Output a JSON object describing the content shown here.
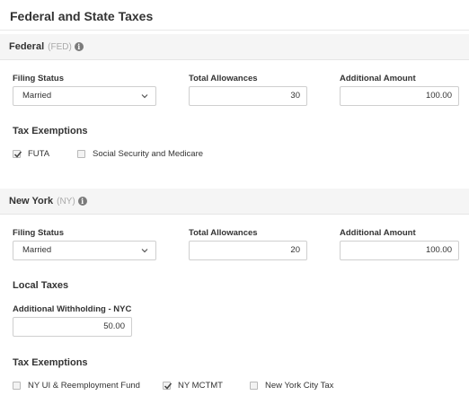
{
  "page": {
    "title": "Federal and State Taxes"
  },
  "federal": {
    "name": "Federal",
    "code": "(FED)",
    "filing_status_label": "Filing Status",
    "filing_status_value": "Married",
    "allowances_label": "Total Allowances",
    "allowances_value": "30",
    "additional_label": "Additional Amount",
    "additional_value": "100.00",
    "exemptions_title": "Tax Exemptions",
    "exemptions": [
      {
        "label": "FUTA",
        "checked": true
      },
      {
        "label": "Social Security and Medicare",
        "checked": false
      }
    ]
  },
  "state": {
    "name": "New York",
    "code": "(NY)",
    "filing_status_label": "Filing Status",
    "filing_status_value": "Married",
    "allowances_label": "Total Allowances",
    "allowances_value": "20",
    "additional_label": "Additional Amount",
    "additional_value": "100.00",
    "local_title": "Local Taxes",
    "local_withholding_label": "Additional Withholding - NYC",
    "local_withholding_value": "50.00",
    "exemptions_title": "Tax Exemptions",
    "exemptions": [
      {
        "label": "NY UI & Reemployment Fund",
        "checked": false
      },
      {
        "label": "NY MCTMT",
        "checked": true
      },
      {
        "label": "New York City Tax",
        "checked": false
      }
    ]
  },
  "icons": {
    "info": "info-icon",
    "select_arrow": "chevron-down-icon",
    "checkmark": "check-icon"
  }
}
